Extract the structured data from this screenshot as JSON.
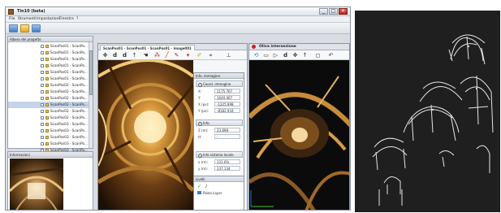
{
  "window": {
    "title": "Tin10 (beta)",
    "minimize": "_",
    "maximize": "□",
    "close": "✕"
  },
  "menu": [
    "File",
    "Strumenti",
    "Impostazioni",
    "Finestra",
    "?"
  ],
  "project_panel": {
    "title": "Albero del progetto",
    "items": [
      "ScanPos01 - ScanPo...",
      "ScanPos01 - ScanPo...",
      "ScanPos01 - ScanPo...",
      "ScanPos01 - ScanPo...",
      "ScanPos01 - ScanPo...",
      "ScanPos01 - ScanPo...",
      "ScanPos02 - ScanPo...",
      "ScanPos02 - ScanPo...",
      "ScanPos02 - ScanPo...",
      "ScanPos02 - ScanPo...",
      "ScanPos02 - ScanPo...",
      "ScanPos02 - ScanPo...",
      "ScanPos03 - ScanPo...",
      "ScanPos03 - ScanPo...",
      "ScanPos03 - ScanPo...",
      "ScanPos03 - ScanPo...",
      "ScanPos03 - ScanPo..."
    ],
    "selected_index": 9
  },
  "info_small": {
    "title": "Informazioni"
  },
  "viewer": {
    "tabs": [
      "ScanPos01 - ScanPos01 - ScanPos01 - image001"
    ],
    "icons": [
      "pan-icon",
      "d-icon",
      "d-alt-icon",
      "arrow-up-icon",
      "hand-icon",
      "marker-icon",
      "line-icon",
      "pen-icon",
      "brush-icon",
      "pin-icon"
    ]
  },
  "info_panel": {
    "title": "Info. immagine",
    "sections": [
      {
        "title": "Coord. immagine",
        "rows": [
          {
            "k": "X:",
            "v": "1175.767"
          },
          {
            "k": "Y:",
            "v": "1640.467"
          },
          {
            "k": "X (px):",
            "v": "-1225.898"
          },
          {
            "k": "Y (px):",
            "v": "-8182.934"
          }
        ]
      },
      {
        "title": "Info.",
        "rows": [
          {
            "k": "Z (m):",
            "v": "23.898"
          },
          {
            "k": "H:",
            "v": "-"
          }
        ]
      },
      {
        "title": "Info sistema locale",
        "rows": [
          {
            "k": "x (m):",
            "v": "131.6%"
          },
          {
            "k": "y (m):",
            "v": "137.134"
          }
        ]
      }
    ]
  },
  "layers": {
    "title": "Livelli",
    "item": "Piano Layer"
  },
  "cloud_window": {
    "title": "Oliva intersezione"
  },
  "colors": {
    "title_blue": "#3f7dc4",
    "gold": "#dba92a",
    "dark": "#1f1f1f"
  }
}
